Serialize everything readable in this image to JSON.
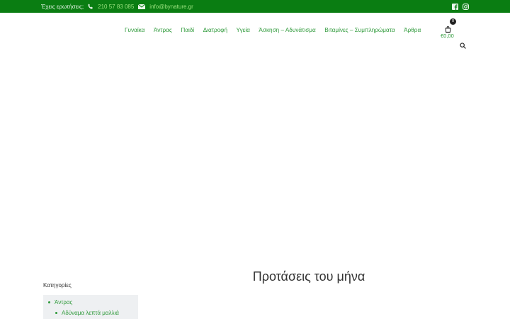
{
  "topbar": {
    "question_label": "Έχεις ερωτήσεις;",
    "phone": "210 57 83 085",
    "email": "info@bynature.gr",
    "icons": {
      "phone": "phone-icon",
      "email": "envelope-icon",
      "facebook": "facebook-icon",
      "instagram": "instagram-icon"
    },
    "colors": {
      "background": "#0a7d12",
      "accent": "#9be27f"
    }
  },
  "nav": {
    "items": [
      {
        "label": "Γυναίκα"
      },
      {
        "label": "Άντρας"
      },
      {
        "label": "Παιδί"
      },
      {
        "label": "Διατροφή"
      },
      {
        "label": "Υγεία"
      },
      {
        "label": "Άσκηση – Αδυνάτισμα"
      },
      {
        "label": "Βιταμίνες – Συμπληρώματα"
      },
      {
        "label": "Άρθρα"
      }
    ],
    "color": "#2f9a3b"
  },
  "cart": {
    "count": "0",
    "total": "€0,00",
    "icon": "shopping-bag-icon"
  },
  "search": {
    "icon": "search-icon"
  },
  "sidebar": {
    "title": "Κατηγορίες",
    "categories": [
      {
        "label": "Άντρας"
      },
      {
        "label": "Αδύναμα λεπτά μαλλιά"
      }
    ]
  },
  "main": {
    "section_title": "Προτάσεις του μήνα"
  }
}
